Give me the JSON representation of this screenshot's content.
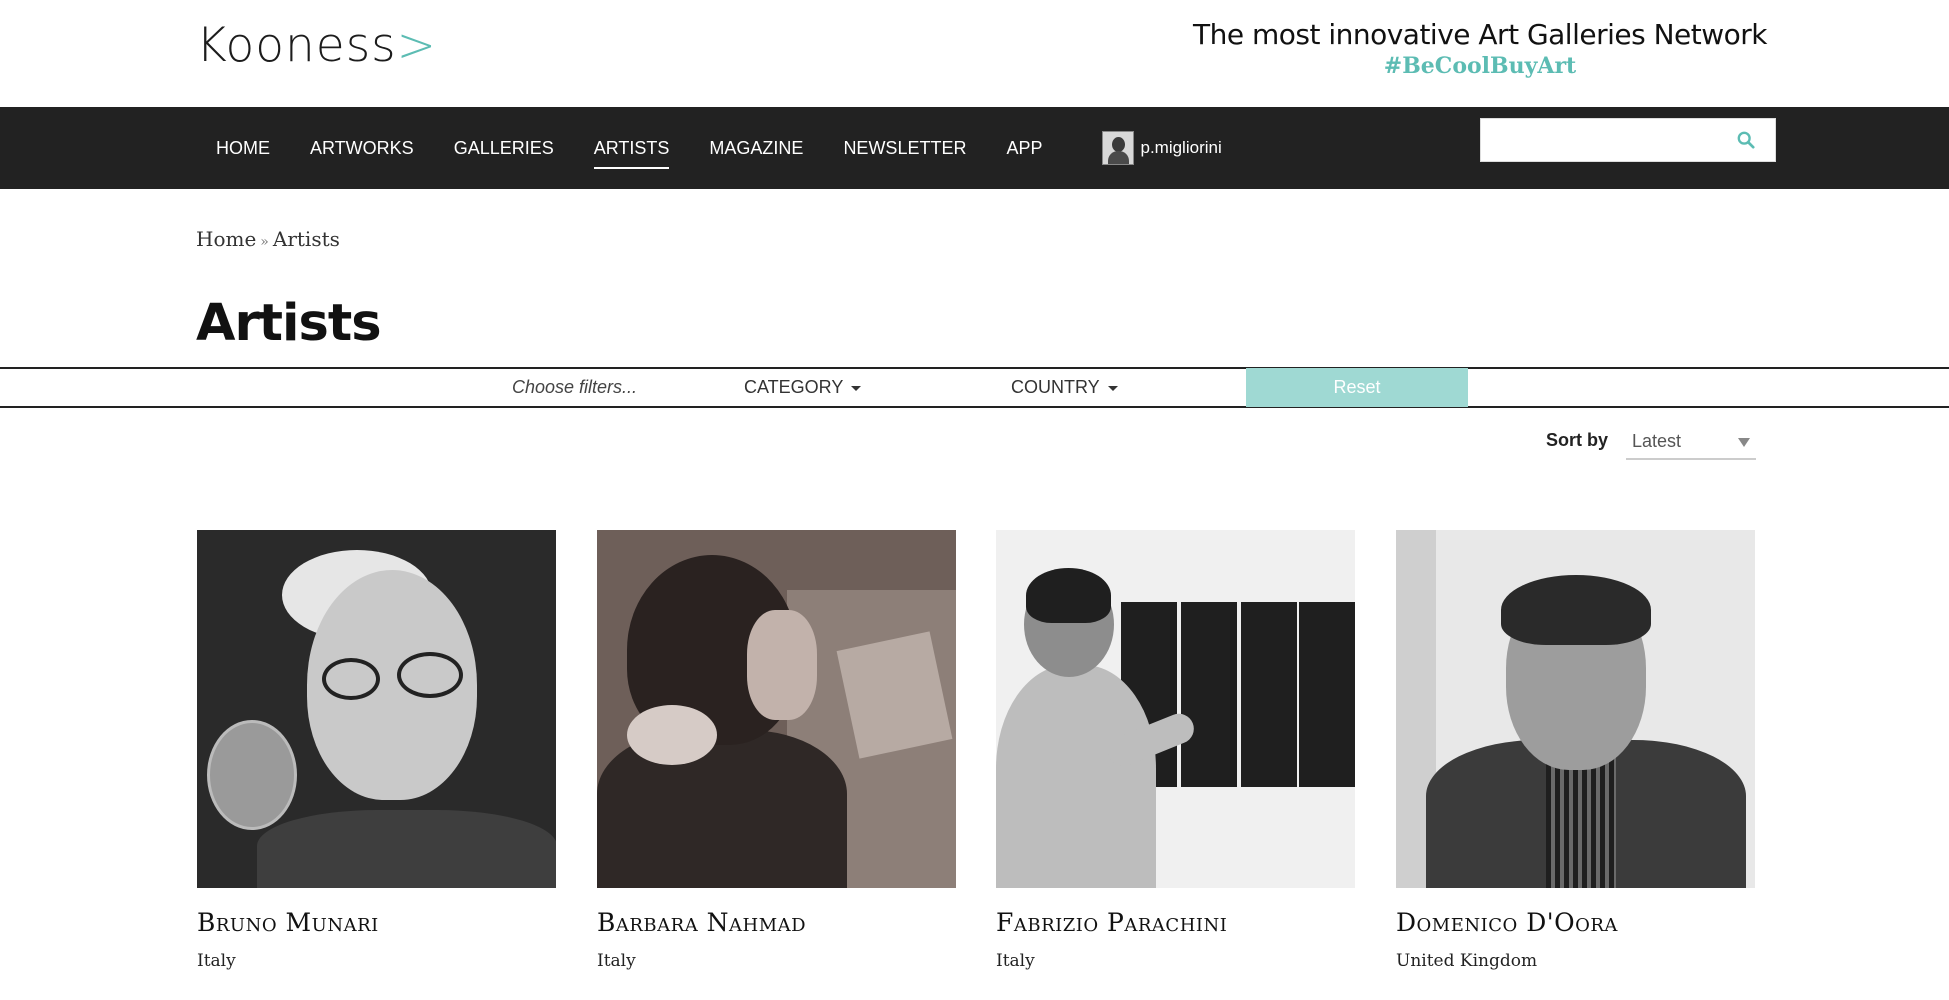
{
  "header": {
    "logo_text": "Kooness",
    "logo_chevron": ">",
    "tagline": "The most innovative Art Galleries Network",
    "hashtag": "#BeCoolBuyArt"
  },
  "nav": {
    "items": [
      {
        "label": "HOME"
      },
      {
        "label": "ARTWORKS"
      },
      {
        "label": "GALLERIES"
      },
      {
        "label": "ARTISTS",
        "active": true
      },
      {
        "label": "MAGAZINE"
      },
      {
        "label": "NEWSLETTER"
      },
      {
        "label": "APP"
      }
    ],
    "username": "p.migliorini"
  },
  "search": {
    "placeholder": "",
    "icon": "search-icon"
  },
  "breadcrumb": {
    "home": "Home",
    "separator": "»",
    "current": "Artists"
  },
  "page_title": "Artists",
  "filters": {
    "hint": "Choose filters...",
    "category_label": "CATEGORY",
    "country_label": "COUNTRY",
    "reset_label": "Reset"
  },
  "sort": {
    "label": "Sort by",
    "value": "Latest"
  },
  "artists": [
    {
      "name": "Bruno Munari",
      "country": "Italy"
    },
    {
      "name": "Barbara Nahmad",
      "country": "Italy"
    },
    {
      "name": "Fabrizio Parachini",
      "country": "Italy"
    },
    {
      "name": "Domenico D'Oora",
      "country": "United Kingdom"
    }
  ],
  "colors": {
    "accent": "#5cbcb3",
    "navbar": "#222222",
    "reset_button": "#9fd9d3"
  }
}
